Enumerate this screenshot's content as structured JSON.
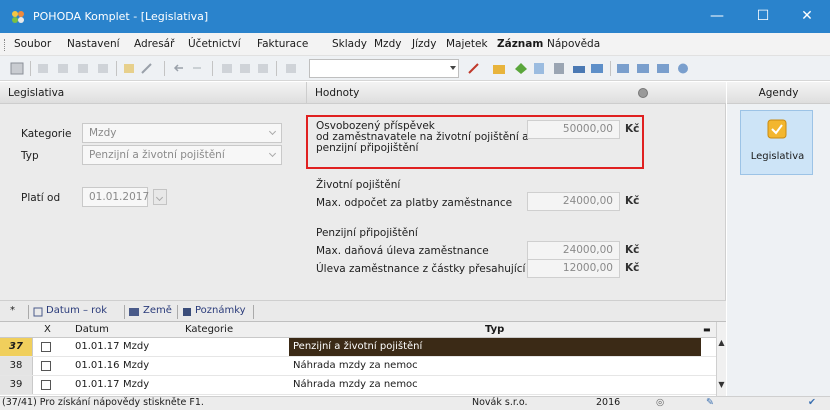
{
  "window": {
    "title": "POHODA Komplet - [Legislativa]",
    "minimize": "—",
    "maximize": "☐",
    "close": "✕"
  },
  "menu": [
    "Soubor",
    "Nastavení",
    "Adresář",
    "Účetnictví",
    "Fakturace",
    "Sklady",
    "Mzdy",
    "Jízdy",
    "Majetek",
    "Záznam",
    "Nápověda"
  ],
  "left_pane": {
    "header": "Legislativa",
    "kategorie_label": "Kategorie",
    "kategorie_value": "Mzdy",
    "typ_label": "Typ",
    "typ_value": "Penzijní a životní pojištění",
    "plati_od_label": "Platí od",
    "plati_od_value": "01.01.2017"
  },
  "right_pane": {
    "header": "Hodnoty",
    "osvobozeny_label": "Osvobozený příspěvek\nod zaměstnavatele na životní pojištění a\npenzijní připojištění",
    "osvobozeny_value": "50000,00",
    "zivotni_header": "Životní pojištění",
    "max_odpocet_label": "Max. odpočet za platby zaměstnance",
    "max_odpocet_value": "24000,00",
    "penzijni_header": "Penzijní připojištění",
    "max_danova_label": "Max. daňová úleva zaměstnance",
    "max_danova_value": "24000,00",
    "uleva_label": "Úleva zaměstnance z částky přesahující",
    "uleva_value": "12000,00",
    "currency": "Kč"
  },
  "agendy": {
    "header": "Agendy",
    "item_label": "Legislativa"
  },
  "tabs": {
    "star": "*",
    "datum_rok": "Datum – rok",
    "zeme": "Země",
    "poznamky": "Poznámky"
  },
  "table": {
    "columns": [
      "X",
      "Datum",
      "Kategorie",
      "Typ"
    ],
    "rows": [
      {
        "num": "37",
        "datum": "01.01.17",
        "kategorie": "Mzdy",
        "typ": "Penzijní a životní pojištění"
      },
      {
        "num": "38",
        "datum": "01.01.16",
        "kategorie": "Mzdy",
        "typ": "Náhrada mzdy za nemoc"
      },
      {
        "num": "39",
        "datum": "01.01.17",
        "kategorie": "Mzdy",
        "typ": "Náhrada mzdy za nemoc"
      }
    ]
  },
  "status": {
    "help": "(37/41) Pro získání nápovědy stiskněte F1.",
    "company": "Novák s.r.o.",
    "year": "2016"
  },
  "colors": {
    "titlebar": "#2a83cc",
    "highlight_border": "#e02020",
    "selected_row": "#3b2a16"
  }
}
